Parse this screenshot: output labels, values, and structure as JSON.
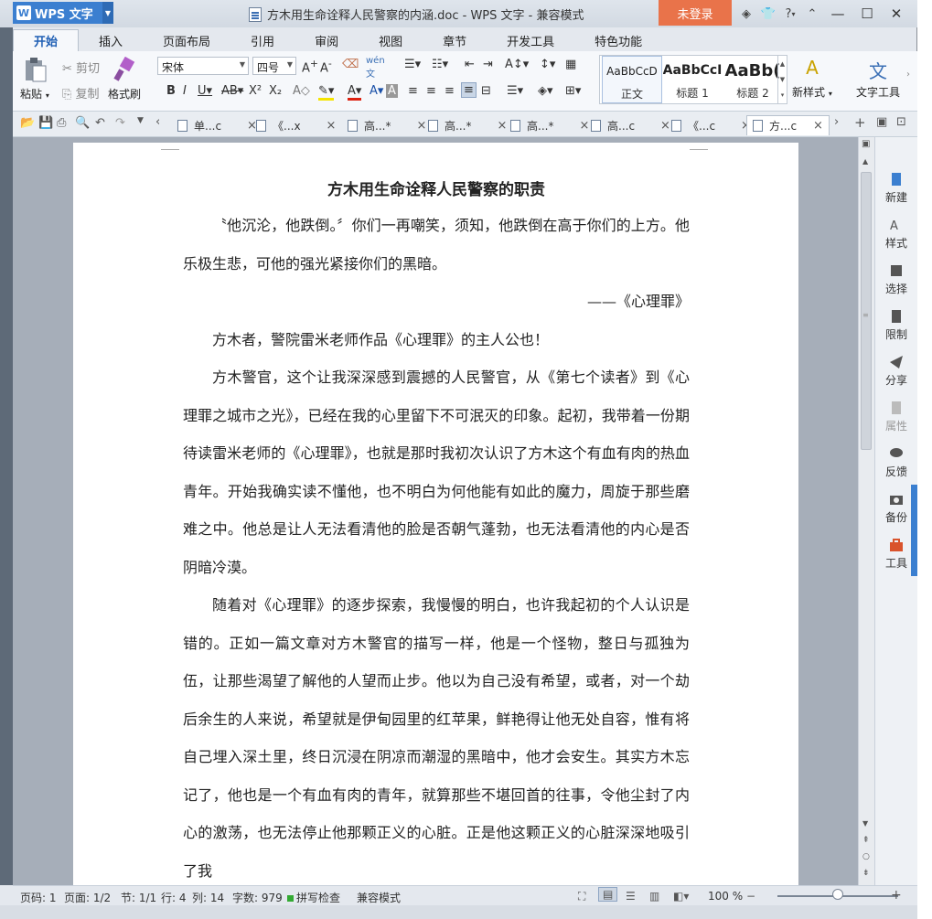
{
  "app": {
    "logo": "WPS 文字",
    "title": "方木用生命诠释人民警察的内涵.doc - WPS 文字 - 兼容模式",
    "login": "未登录",
    "help": "?"
  },
  "menu": [
    "开始",
    "插入",
    "页面布局",
    "引用",
    "审阅",
    "视图",
    "章节",
    "开发工具",
    "特色功能"
  ],
  "ribbon": {
    "paste": "粘贴",
    "cut": "剪切",
    "copy": "复制",
    "format_painter": "格式刷",
    "font": "宋体",
    "size": "四号",
    "styles": [
      {
        "preview": "AaBbCcD",
        "label": "正文"
      },
      {
        "preview": "AaBbCcI",
        "label": "标题 1"
      },
      {
        "preview": "AaBb(",
        "label": "标题 2"
      }
    ],
    "new_style": "新样式",
    "text_tools": "文字工具"
  },
  "tabs": [
    "单...c",
    "《...x",
    "高...*",
    "高...*",
    "高...*",
    "高...c",
    "《...c",
    "方...c"
  ],
  "document": {
    "title": "方木用生命诠释人民警察的职责",
    "quote1": "〝他沉沦，他跌倒。〞你们一再嘲笑，须知，他跌倒在高于你们的上方。他乐极生悲，可他的强光紧接你们的黑暗。",
    "quote_src": "——《心理罪》",
    "p1": "方木者，警院雷米老师作品《心理罪》的主人公也！",
    "p2": "方木警官，这个让我深深感到震撼的人民警官，从《第七个读者》到《心理罪之城市之光》，已经在我的心里留下不可泯灭的印象。起初，我带着一份期待读雷米老师的《心理罪》，也就是那时我初次认识了方木这个有血有肉的热血青年。开始我确实读不懂他，也不明白为何他能有如此的魔力，周旋于那些磨难之中。他总是让人无法看清他的脸是否朝气蓬勃，也无法看清他的内心是否阴暗冷漠。",
    "p3": "随着对《心理罪》的逐步探索，我慢慢的明白，也许我起初的个人认识是错的。正如一篇文章对方木警官的描写一样，他是一个怪物，整日与孤独为伍，让那些渴望了解他的人望而止步。他以为自己没有希望，或者，对一个劫后余生的人来说，希望就是伊甸园里的红苹果，鲜艳得让他无处自容，惟有将自己埋入深土里，终日沉浸在阴凉而潮湿的黑暗中，他才会安生。其实方木忘记了，他也是一个有血有肉的青年，就算那些不堪回首的往事，令他尘封了内心的激荡，也无法停止他那颗正义的心脏。正是他这颗正义的心脏深深地吸引了我"
  },
  "side": [
    "新建",
    "样式",
    "选择",
    "限制",
    "分享",
    "属性",
    "反馈",
    "备份",
    "工具"
  ],
  "status": {
    "page_no": "页码: 1",
    "pages": "页面: 1/2",
    "section": "节: 1/1",
    "row": "行: 4",
    "col": "列: 14",
    "words": "字数: 979",
    "spell": "拼写检查",
    "mode": "兼容模式",
    "zoom": "100 %"
  },
  "zoom_level": 1.0
}
